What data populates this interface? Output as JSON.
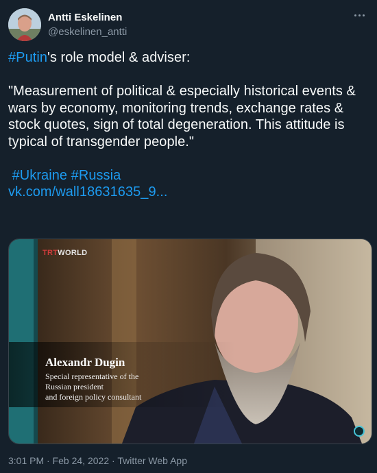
{
  "author": {
    "display_name": "Antti Eskelinen",
    "handle": "@eskelinen_antti"
  },
  "tweet": {
    "hashtag_putin": "#Putin",
    "line1_rest": "'s role model & adviser:",
    "quote": "\"Measurement of political & especially historical events & wars by economy, monitoring trends, exchange rates & stock quotes, sign of total degeneration. This attitude is typical of transgender people.\"",
    "hashtag_ukraine": "#Ukraine",
    "hashtag_russia": "#Russia",
    "link_text": "vk.com/wall18631635_9..."
  },
  "media": {
    "brand_prefix": "TRT",
    "brand_suffix": "WORLD",
    "caption_name": "Alexandr Dugin",
    "caption_line1": "Special representative of the",
    "caption_line2": "Russian president",
    "caption_line3": "and foreign policy consultant"
  },
  "meta": {
    "time": "3:01 PM",
    "date": "Feb 24, 2022",
    "app": "Twitter Web App",
    "separator": "·"
  },
  "icons": {
    "more": "more-horizontal-icon",
    "gif_badge": "media-indicator-icon"
  },
  "colors": {
    "background": "#15202b",
    "text": "#f7f9f9",
    "secondary": "#8b98a5",
    "link": "#1d9bf0"
  }
}
